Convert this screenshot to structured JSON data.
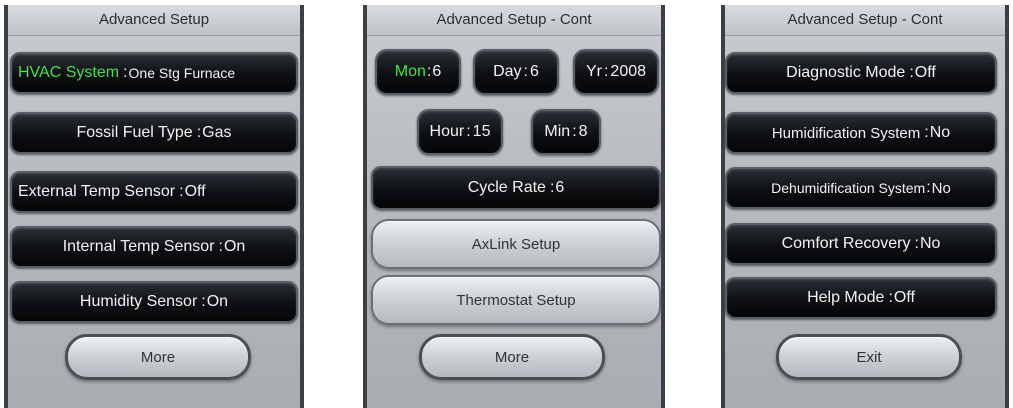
{
  "panel1": {
    "title": "Advanced Setup",
    "hvac_label": "HVAC System",
    "hvac_value": "One Stg Furnace",
    "fossil_label": "Fossil Fuel Type",
    "fossil_value": "Gas",
    "ext_label": "External Temp Sensor",
    "ext_value": "Off",
    "int_label": "Internal Temp Sensor",
    "int_value": "On",
    "hum_label": "Humidity Sensor",
    "hum_value": "On",
    "more": "More"
  },
  "panel2": {
    "title": "Advanced Setup - Cont",
    "mon_label": "Mon",
    "mon_value": "6",
    "day_label": "Day",
    "day_value": "6",
    "yr_label": "Yr",
    "yr_value": "2008",
    "hour_label": "Hour",
    "hour_value": "15",
    "min_label": "Min",
    "min_value": "8",
    "cycle_label": "Cycle Rate",
    "cycle_value": "6",
    "axlink": "AxLink Setup",
    "thermostat": "Thermostat Setup",
    "more": "More"
  },
  "panel3": {
    "title": "Advanced Setup - Cont",
    "diag_label": "Diagnostic Mode",
    "diag_value": "Off",
    "humid_label": "Humidification System",
    "humid_value": "No",
    "dehumid_label": "Dehumidification System",
    "dehumid_value": "No",
    "comfort_label": "Comfort Recovery",
    "comfort_value": "No",
    "help_label": "Help Mode",
    "help_value": "Off",
    "exit": "Exit"
  },
  "colors": {
    "highlight": "#44e24a",
    "row_bg": "#0d0f12",
    "button_bg": "#cfd3d8"
  }
}
